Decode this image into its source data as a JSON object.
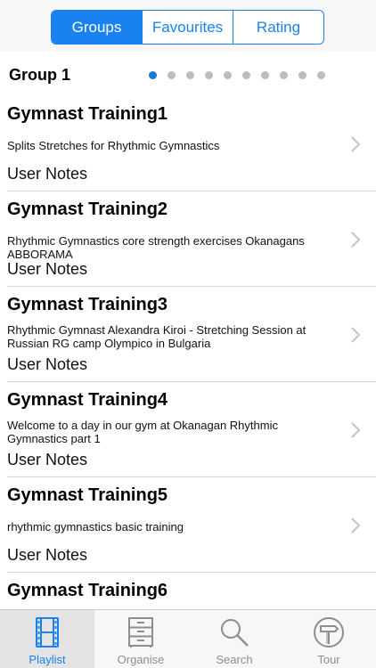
{
  "segments": [
    {
      "label": "Groups",
      "active": true
    },
    {
      "label": "Favourites",
      "active": false
    },
    {
      "label": "Rating",
      "active": false
    }
  ],
  "group": {
    "title": "Group 1",
    "page_count": 10,
    "current_page": 1
  },
  "items": [
    {
      "title": "Gymnast Training1",
      "description": "Splits Stretches for Rhythmic Gymnastics",
      "notes": "User Notes"
    },
    {
      "title": "Gymnast Training2",
      "description": "Rhythmic Gymnastics core strength exercises Okanagans ABBORAMA",
      "notes": "User Notes"
    },
    {
      "title": "Gymnast Training3",
      "description": "Rhythmic Gymnast Alexandra Kiroi - Stretching Session at Russian RG camp Olympico in Bulgaria",
      "notes": "User Notes"
    },
    {
      "title": "Gymnast Training4",
      "description": "Welcome to a day in our gym at Okanagan Rhythmic Gymnastics part 1",
      "notes": "User Notes"
    },
    {
      "title": "Gymnast Training5",
      "description": "rhythmic gymnastics basic training",
      "notes": "User Notes"
    },
    {
      "title": "Gymnast Training6",
      "description": "",
      "notes": ""
    }
  ],
  "tabbar": {
    "tabs": [
      {
        "label": "Playlist",
        "icon": "film-strip-icon",
        "active": true
      },
      {
        "label": "Organise",
        "icon": "cabinet-icon",
        "active": false
      },
      {
        "label": "Search",
        "icon": "magnifier-icon",
        "active": false
      },
      {
        "label": "Tour",
        "icon": "signpost-icon",
        "active": false
      }
    ]
  },
  "colors": {
    "accent": "#1a82f0",
    "inactive_tab": "#8e8e8e",
    "dot_inactive": "#bdbdbd"
  }
}
